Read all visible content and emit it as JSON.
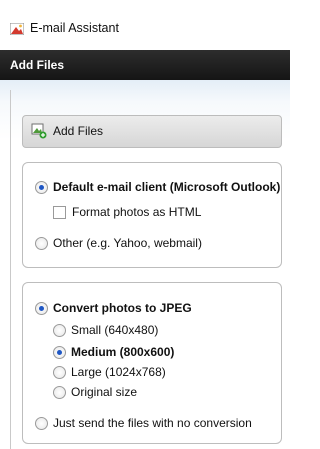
{
  "window": {
    "title": "E-mail Assistant",
    "icon": "email-assistant-icon"
  },
  "header": {
    "title": "Add Files"
  },
  "add_files_button": {
    "label": "Add Files",
    "icon": "add-files-icon"
  },
  "client_group": {
    "default_client": {
      "label": "Default e-mail client (Microsoft Outlook)",
      "selected": true
    },
    "format_html": {
      "label": "Format photos as HTML",
      "checked": false
    },
    "other_client": {
      "label": "Other (e.g. Yahoo, webmail)",
      "selected": false
    }
  },
  "conversion_group": {
    "convert_jpeg": {
      "label": "Convert photos to JPEG",
      "selected": true
    },
    "sizes": [
      {
        "label": "Small (640x480)",
        "selected": false
      },
      {
        "label": "Medium (800x600)",
        "selected": true
      },
      {
        "label": "Large (1024x768)",
        "selected": false
      },
      {
        "label": "Original size",
        "selected": false
      }
    ],
    "no_conversion": {
      "label": "Just send the files with no conversion",
      "selected": false
    }
  },
  "colors": {
    "header_bg": "#1e1e1e",
    "accent": "#1f57c4"
  }
}
